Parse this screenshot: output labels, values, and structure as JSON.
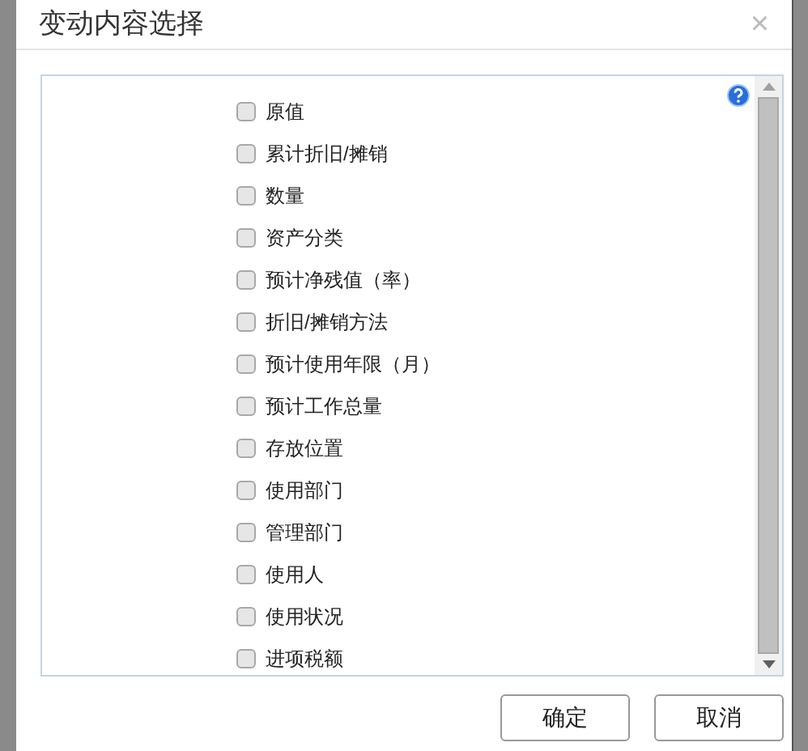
{
  "dialog": {
    "title": "变动内容选择",
    "close": "×"
  },
  "options": [
    {
      "label": "原值",
      "checked": false
    },
    {
      "label": "累计折旧/摊销",
      "checked": false
    },
    {
      "label": "数量",
      "checked": false
    },
    {
      "label": "资产分类",
      "checked": false
    },
    {
      "label": "预计净残值（率）",
      "checked": false
    },
    {
      "label": "折旧/摊销方法",
      "checked": false
    },
    {
      "label": "预计使用年限（月）",
      "checked": false
    },
    {
      "label": "预计工作总量",
      "checked": false
    },
    {
      "label": "存放位置",
      "checked": false
    },
    {
      "label": "使用部门",
      "checked": false
    },
    {
      "label": "管理部门",
      "checked": false
    },
    {
      "label": "使用人",
      "checked": false
    },
    {
      "label": "使用状况",
      "checked": false
    },
    {
      "label": "进项税额",
      "checked": false
    }
  ],
  "buttons": [
    "确定",
    "取消"
  ]
}
